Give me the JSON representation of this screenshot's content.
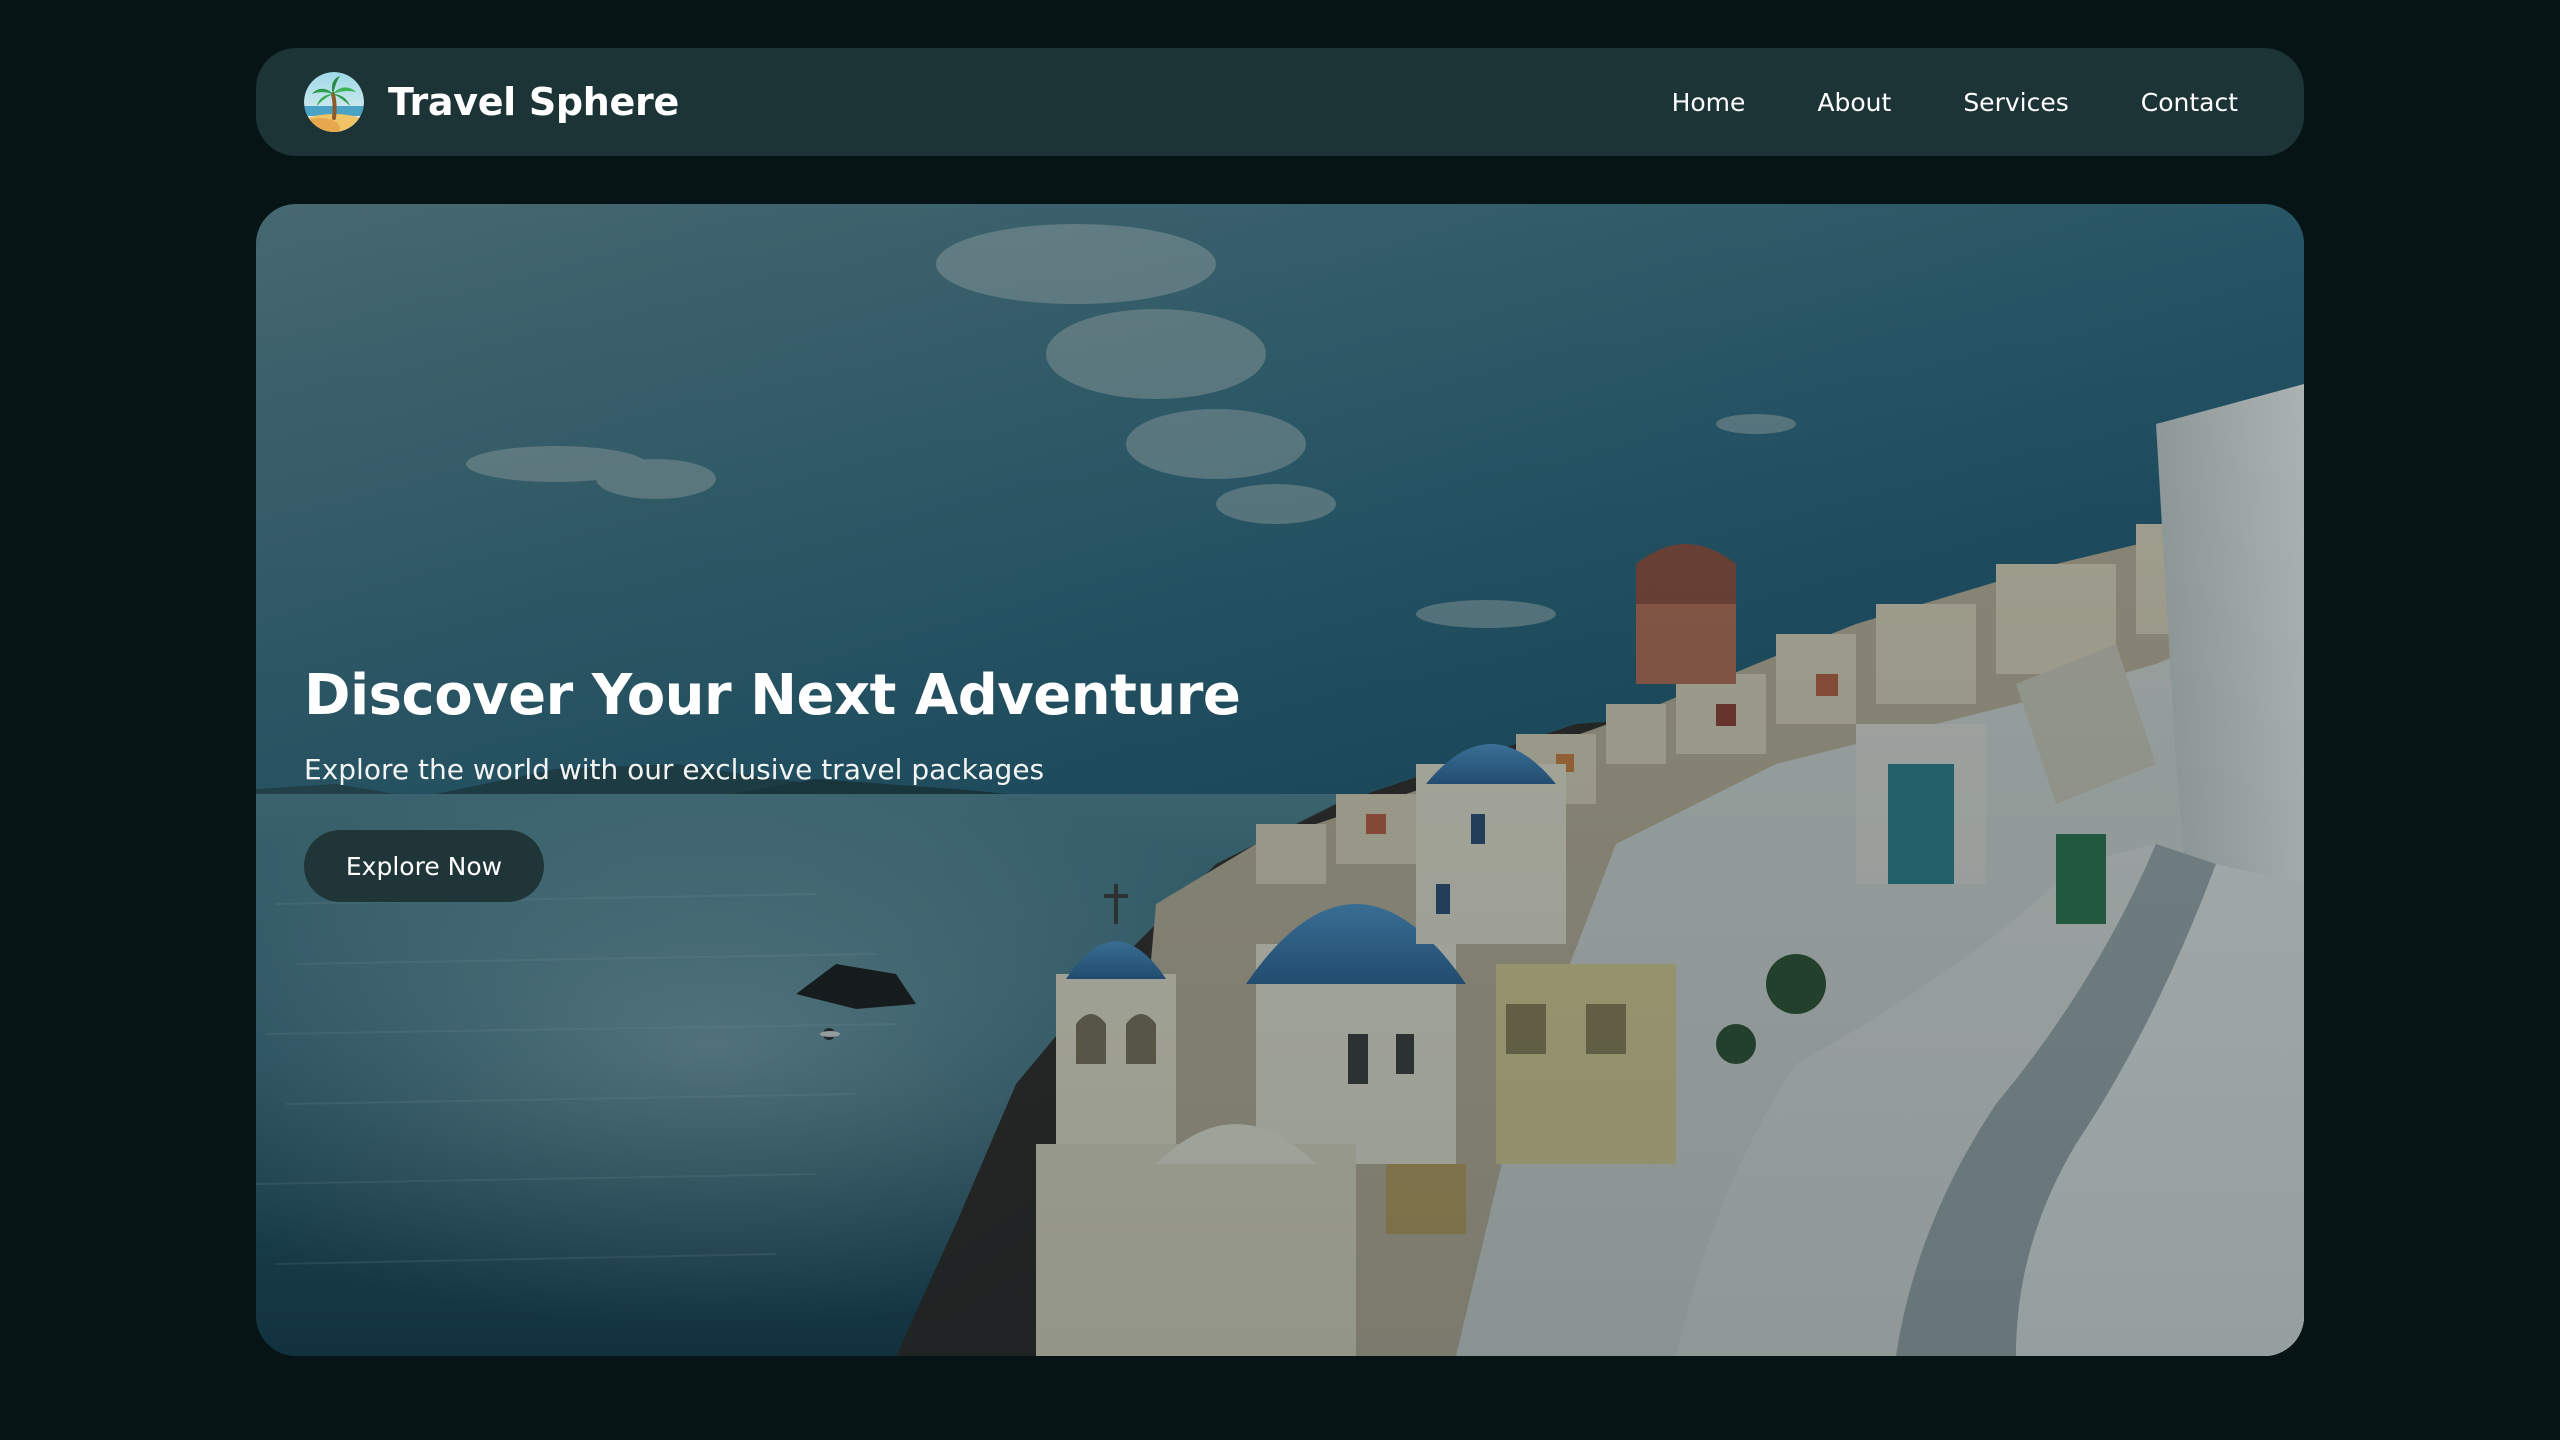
{
  "brand": {
    "name": "Travel Sphere",
    "logo_icon": "palm-tree-island-icon"
  },
  "nav": {
    "items": [
      {
        "label": "Home"
      },
      {
        "label": "About"
      },
      {
        "label": "Services"
      },
      {
        "label": "Contact"
      }
    ]
  },
  "hero": {
    "title": "Discover Your Next Adventure",
    "subtitle": "Explore the world with our exclusive travel packages",
    "cta_label": "Explore Now",
    "background_image": "santorini-coastline-photo"
  },
  "colors": {
    "page_background": "#061416",
    "navbar_background": "#1d3437",
    "button_background": "#1f3537",
    "text": "#ffffff"
  }
}
